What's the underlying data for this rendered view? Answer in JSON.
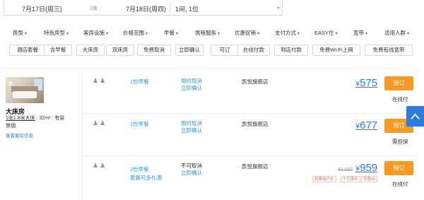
{
  "search": {
    "checkin": "7月17日(周三)",
    "nights": "1晚",
    "checkout": "7月18日(周四)",
    "guests": "1间, 1位",
    "chevron_icon": "chevron-down-icon"
  },
  "filters": [
    "房型",
    "特色房型",
    "客房设施",
    "价格范围",
    "早餐",
    "携程服务",
    "优惠促销",
    "支付方式",
    "EASY住",
    "宽带",
    "适用人群"
  ],
  "tags": [
    "酒店套餐",
    "含早餐",
    "大床房",
    "双床房",
    "免费取消",
    "立即确认",
    "可订",
    "在线付款",
    "到店付款",
    "免费Wi-Fi上网",
    "免费有线宽带"
  ],
  "room": {
    "name": "大床房",
    "bed": "1张1.8米大床",
    "area": "32m²",
    "window": "有窗",
    "smoking": "禁烟",
    "detail_link": "查看客房信息"
  },
  "offers": [
    {
      "meal": "1份早餐",
      "meal_extra": "",
      "cancel1": "限时取消",
      "cancel2": "立即确认",
      "cancel_style": "blue",
      "shop": "凯悦旗舰店",
      "original_price": "",
      "price": "575",
      "currency": "¥",
      "book": "预订",
      "payment": "在线付",
      "badges": []
    },
    {
      "meal": "1份早餐",
      "meal_extra": "",
      "cancel1": "限时取消",
      "cancel2": "立即确认",
      "cancel_style": "blue",
      "shop": "凯悦旗舰店",
      "original_price": "",
      "price": "677",
      "currency": "¥",
      "book": "预订",
      "payment": "需担保",
      "badges": []
    },
    {
      "meal": "2份早餐",
      "meal_extra": "套餐可多扎酒",
      "cancel1": "不可取消",
      "cancel2": "立即确认",
      "cancel_style": "gray",
      "shop": "凯悦旗舰店",
      "original_price": "¥1,027",
      "price": "959",
      "currency": "¥",
      "book": "预订",
      "payment": "在线付",
      "badges": [
        "机票用户价",
        "十亿豪补",
        "优惠68"
      ]
    }
  ],
  "colors": {
    "accent_blue": "#2d7dde",
    "link_blue": "#2d9bd7",
    "book_orange": "#f59a23"
  },
  "back_to_top_icon": "arrow-up-icon"
}
